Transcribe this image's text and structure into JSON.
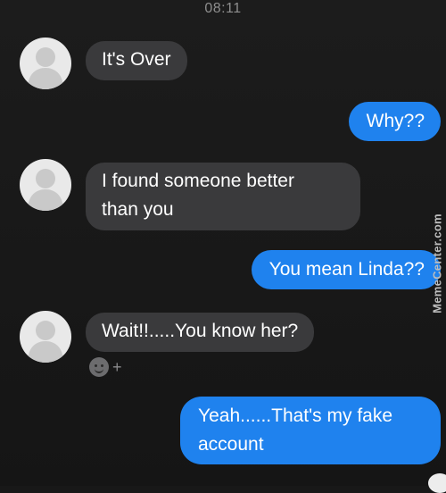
{
  "status_bar": {
    "time": "08:11"
  },
  "messages": [
    {
      "from": "them",
      "text": "It's Over"
    },
    {
      "from": "me",
      "text": "Why??"
    },
    {
      "from": "them",
      "line1": "I found someone better",
      "line2": "than you"
    },
    {
      "from": "me",
      "text": "You mean Linda??"
    },
    {
      "from": "them",
      "text": "Wait!!.....You know her?"
    },
    {
      "from": "me",
      "line1": "Yeah......That's my fake",
      "line2": "account"
    }
  ],
  "reaction_bar": {
    "icon": "emoji-icon",
    "plus": "+"
  },
  "watermark": "MemeCenter.com",
  "colors": {
    "background": "#181818",
    "incoming_bubble": "#3a3a3c",
    "outgoing_bubble": "#1f82ee",
    "text": "#ffffff"
  }
}
